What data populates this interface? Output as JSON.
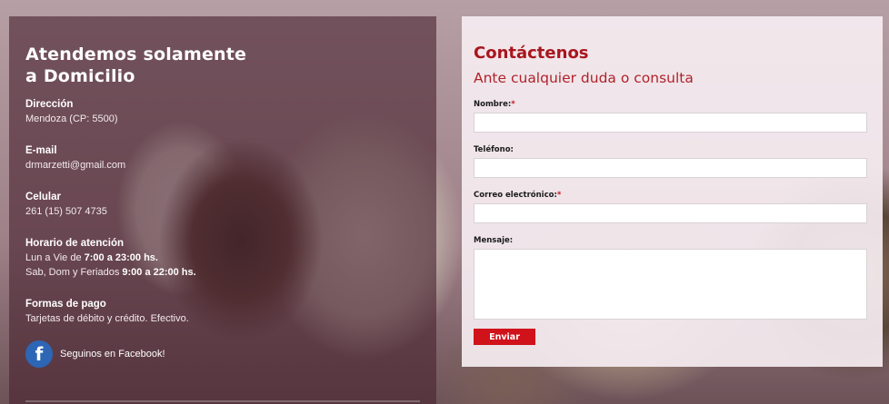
{
  "info": {
    "title": "Atendemos solamente a Domicilio",
    "blocks": [
      {
        "label": "Dirección",
        "lines": [
          "Mendoza (CP: 5500)"
        ]
      },
      {
        "label": "E-mail",
        "lines": [
          "drmarzetti@gmail.com"
        ]
      },
      {
        "label": "Celular",
        "lines": [
          "261 (15) 507 4735"
        ]
      }
    ],
    "horario": {
      "label": "Horario de atención",
      "line1_prefix": "Lun a Vie de ",
      "line1_bold": "7:00 a 23:00 hs.",
      "line2_prefix": "Sab, Dom y Feriados ",
      "line2_bold": "9:00 a 22:00 hs."
    },
    "pago": {
      "label": "Formas de pago",
      "value": "Tarjetas de débito y crédito. Efectivo."
    },
    "facebook": {
      "icon": "f",
      "text": "Seguinos en Facebook!"
    }
  },
  "contact": {
    "title": "Contáctenos",
    "subtitle": "Ante cualquier duda o consulta",
    "fields": {
      "nombre": {
        "label": "Nombre:",
        "required_mark": "*",
        "value": ""
      },
      "telefono": {
        "label": "Teléfono:",
        "value": ""
      },
      "correo": {
        "label": "Correo electrónico:",
        "required_mark": "*",
        "value": ""
      },
      "mensaje": {
        "label": "Mensaje:",
        "value": ""
      }
    },
    "submit_label": "Enviar"
  },
  "colors": {
    "accent": "#d0121b",
    "title_red": "#a8161e",
    "facebook_blue": "#2d66b5",
    "left_overlay": "#482430"
  }
}
